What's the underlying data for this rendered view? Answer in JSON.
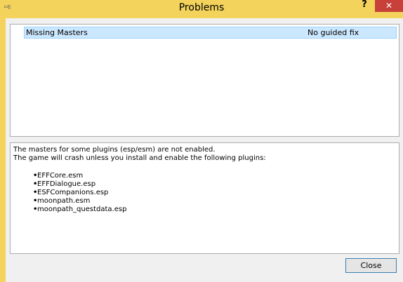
{
  "window": {
    "title": "Problems",
    "app_icon_glyph": "▭▯",
    "help_label": "?",
    "close_label": "✕"
  },
  "problems": {
    "rows": [
      {
        "name": "Missing Masters",
        "status": "No guided fix"
      }
    ]
  },
  "details": {
    "line1": "The masters for some plugins (esp/esm) are not enabled.",
    "line2": "The game will crash unless you install and enable the following plugins:",
    "plugins": [
      "EFFCore.esm",
      "EFFDialogue.esp",
      "ESFCompanions.esp",
      "moonpath.esm",
      "moonpath_questdata.esp"
    ]
  },
  "footer": {
    "close_button_label": "Close"
  },
  "colors": {
    "titlebar": "#f3d35c",
    "selection": "#cce8ff",
    "close_x": "#c7403a"
  }
}
